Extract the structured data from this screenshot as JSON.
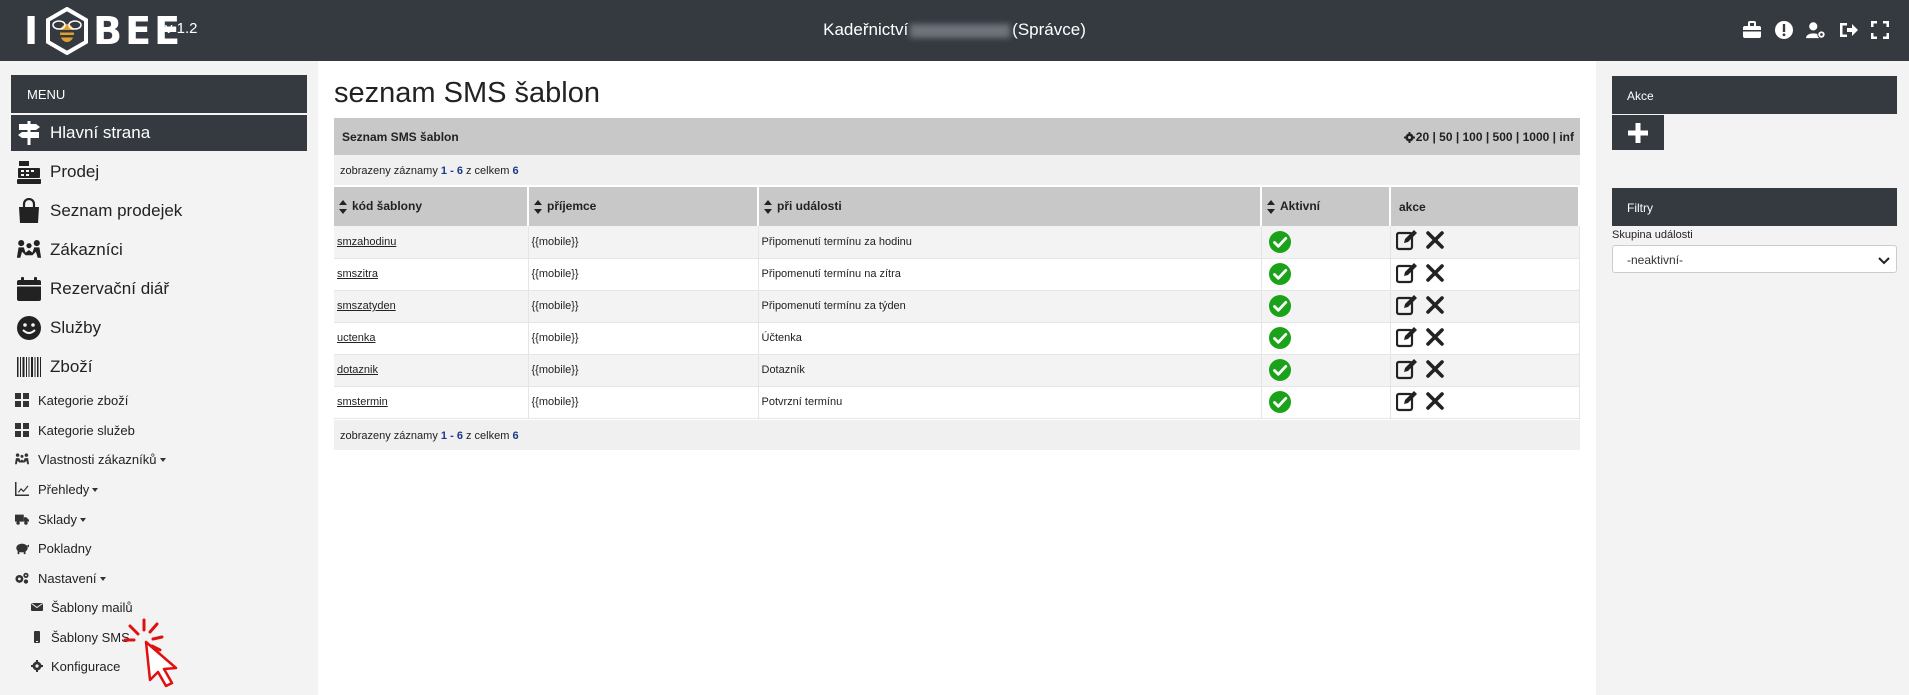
{
  "header": {
    "logo_text_left": "I",
    "logo_text_right": "BEE",
    "version": "v 1.2",
    "title_prefix": "Kadeřnictví",
    "title_suffix": "(Správce)",
    "icons": [
      "briefcase-icon",
      "exclamation-icon",
      "user-gear-icon",
      "sign-out-icon",
      "fullscreen-icon"
    ]
  },
  "sidebar": {
    "menu_label": "MENU",
    "main_items": [
      {
        "label": "Hlavní strana",
        "icon": "signpost-icon",
        "active": true
      },
      {
        "label": "Prodej",
        "icon": "cash-register-icon"
      },
      {
        "label": "Seznam prodejek",
        "icon": "shopping-bag-icon"
      },
      {
        "label": "Zákazníci",
        "icon": "people-icon"
      },
      {
        "label": "Rezervační diář",
        "icon": "calendar-icon"
      },
      {
        "label": "Služby",
        "icon": "smile-icon"
      },
      {
        "label": "Zboží",
        "icon": "barcode-icon"
      }
    ],
    "small_items": [
      {
        "label": "Kategorie zboží",
        "icon": "grid-icon"
      },
      {
        "label": "Kategorie služeb",
        "icon": "grid-icon"
      },
      {
        "label": "Vlastnosti zákazníků",
        "icon": "people-icon",
        "dropdown": true
      },
      {
        "label": "Přehledy",
        "icon": "chart-line-icon",
        "dropdown": true
      },
      {
        "label": "Sklady",
        "icon": "truck-icon",
        "dropdown": true
      },
      {
        "label": "Pokladny",
        "icon": "piggy-bank-icon"
      },
      {
        "label": "Nastavení",
        "icon": "cogs-icon",
        "dropdown": true
      }
    ],
    "sub_items": [
      {
        "label": "Šablony mailů",
        "icon": "envelope-icon"
      },
      {
        "label": "Šablony SMS",
        "icon": "mobile-icon"
      },
      {
        "label": "Konfigurace",
        "icon": "gear-icon"
      }
    ]
  },
  "main": {
    "page_title": "seznam SMS šablon",
    "panel_title": "Seznam SMS šablon",
    "pager": "20 | 50 | 100 | 500 | 1000 | inf",
    "counter": {
      "prefix": "zobrazeny záznamy",
      "from": "1",
      "sep": "-",
      "to": "6",
      "mid": "z celkem",
      "total": "6"
    },
    "columns": [
      "kód šablony",
      "příjemce",
      "při události",
      "Aktivní",
      "akce"
    ],
    "rows": [
      {
        "code": "smzahodinu",
        "recipient": "{{mobile}}",
        "event": "Připomenutí termínu za hodinu",
        "active": true
      },
      {
        "code": "smszitra",
        "recipient": "{{mobile}}",
        "event": "Připomenutí termínu na zítra",
        "active": true
      },
      {
        "code": "smszatyden",
        "recipient": "{{mobile}}",
        "event": "Připomenutí termínu za týden",
        "active": true
      },
      {
        "code": "uctenka",
        "recipient": "{{mobile}}",
        "event": "Účtenka",
        "active": true
      },
      {
        "code": "dotaznik",
        "recipient": "{{mobile}}",
        "event": "Dotazník",
        "active": true
      },
      {
        "code": "smstermin",
        "recipient": "{{mobile}}",
        "event": "Potvrzní termínu",
        "active": true
      }
    ]
  },
  "right": {
    "actions_label": "Akce",
    "filters_label": "Filtry",
    "filter_field_label": "Skupina události",
    "filter_value": "-neaktivní-"
  },
  "colors": {
    "dark": "#343a40",
    "active_green": "#1aa31a",
    "header_gray": "#c8c8c8"
  }
}
